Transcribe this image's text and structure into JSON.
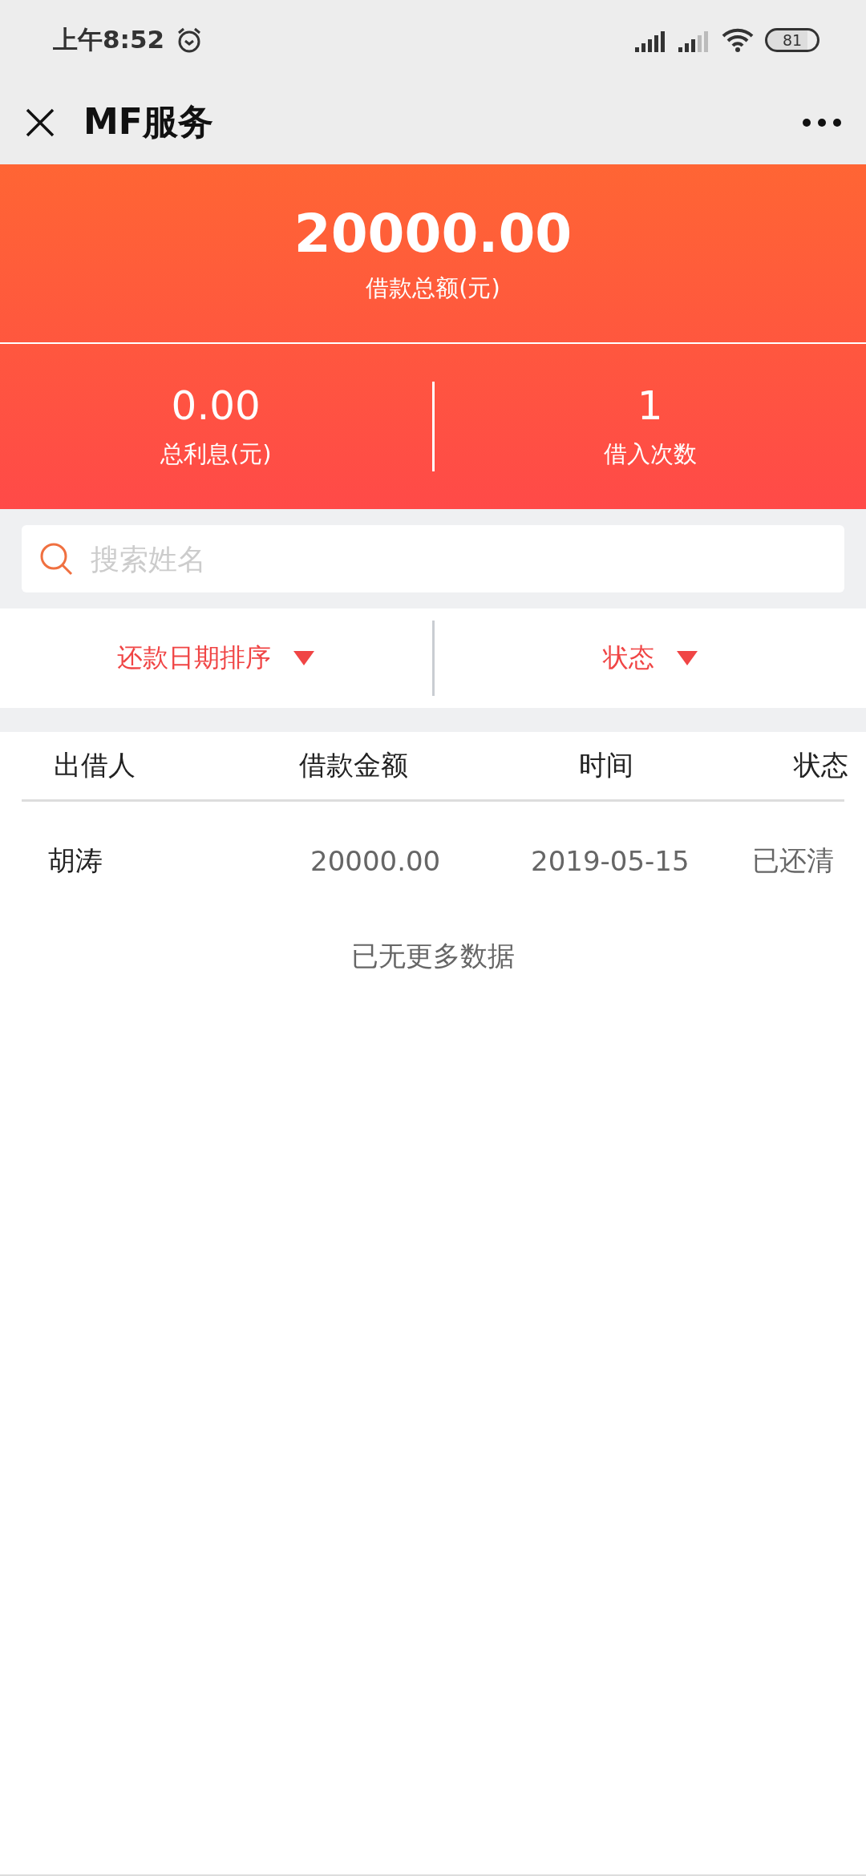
{
  "status_bar": {
    "time": "上午8:52",
    "battery": "81"
  },
  "nav": {
    "title": "MF服务"
  },
  "summary": {
    "total_amount": "20000.00",
    "total_label": "借款总额(元)",
    "stats": [
      {
        "value": "0.00",
        "label": "总利息(元)"
      },
      {
        "value": "1",
        "label": "借入次数"
      }
    ]
  },
  "search": {
    "placeholder": "搜索姓名"
  },
  "filters": [
    {
      "label": "还款日期排序"
    },
    {
      "label": "状态"
    }
  ],
  "table": {
    "columns": [
      "出借人",
      "借款金额",
      "时间",
      "状态"
    ],
    "rows": [
      [
        "胡涛",
        "20000.00",
        "2019-05-15",
        "已还清"
      ]
    ]
  },
  "footer_note": "已无更多数据"
}
